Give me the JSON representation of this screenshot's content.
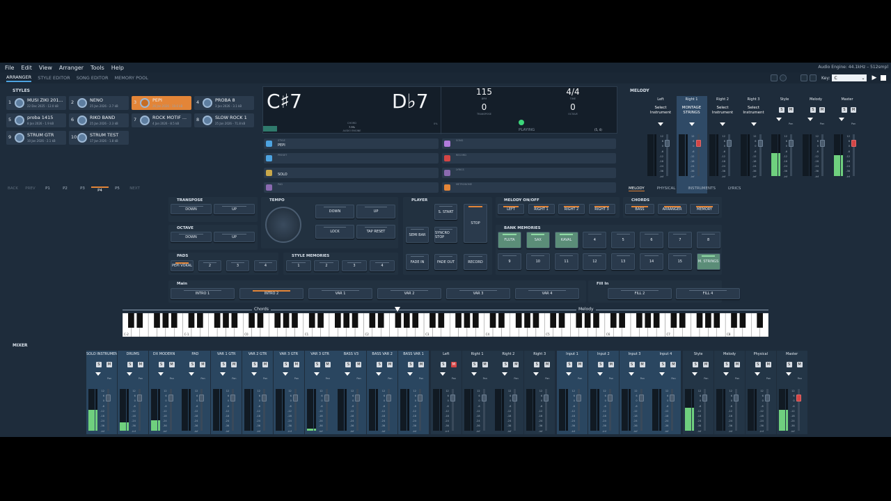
{
  "menu": [
    "File",
    "Edit",
    "View",
    "Arranger",
    "Tools",
    "Help"
  ],
  "engine_status": "Audio Engine: 44.1kHz – 512smpl",
  "tabs": [
    "ARRANGER",
    "STYLE EDITOR",
    "SONG EDITOR",
    "MEMORY POOL"
  ],
  "key_label": "Key:",
  "key_value": "C",
  "styles_title": "STYLES",
  "styles": [
    {
      "num": "1",
      "name": "MUSI ZIKI 201...",
      "date": "22 Dec 2025 - 12.0 kB"
    },
    {
      "num": "2",
      "name": "NENO",
      "date": "25 Jan 2026 - 2.7 kB"
    },
    {
      "num": "3",
      "name": "PEPI",
      "date": "26 Jan 2026 - 19.6 kB"
    },
    {
      "num": "4",
      "name": "PROBA 8",
      "date": "3 Jan 2026 - 3.1 kB"
    },
    {
      "num": "5",
      "name": "proba 1415",
      "date": "8 Jan 2026 - 1.9 kB"
    },
    {
      "num": "6",
      "name": "RIKO BAND",
      "date": "25 Jan 2026 - 2.3 kB"
    },
    {
      "num": "7",
      "name": "ROCK MOTIF ...",
      "date": "4 Jan 2026 - 8.5 kB"
    },
    {
      "num": "8",
      "name": "SLOW ROCK 1",
      "date": "25 Jan 2026 - 71.8 kB"
    },
    {
      "num": "9",
      "name": "STRUM GTR",
      "date": "10 Jan 2026 - 2.1 kB"
    },
    {
      "num": "10",
      "name": "STRUM TEST",
      "date": "17 Jan 2026 - 1.8 kB"
    }
  ],
  "pagenav": [
    "BACK",
    "PREV",
    "P1",
    "P2",
    "P3",
    "P4",
    "P5",
    "NEXT"
  ],
  "display": {
    "chord1": "C♯7",
    "chord2": "D♭7",
    "chord_label": "CHORD",
    "bpm": "115",
    "bpm_label": "BPM",
    "transpose": "0",
    "transpose_label": "TRANSPOSE",
    "time_sig": "4/4",
    "time_label": "TIME",
    "octave": "0",
    "octave_label": "OCTAVE",
    "engine_val": "7.9%",
    "engine_label": "AUDIO ENGINE",
    "playing": "PLAYING",
    "position": "(5, 4)",
    "pct": "0%"
  },
  "info_left": [
    {
      "label": "STYLE",
      "value": "PEPI",
      "color": "#4da3e0"
    },
    {
      "label": "PRESET",
      "value": "",
      "color": "#4da3e0"
    },
    {
      "label": "",
      "value": "SOLO",
      "color": "#c9a84a"
    },
    {
      "label": "PAD",
      "value": "",
      "color": "#8a6ab0"
    }
  ],
  "info_right": [
    {
      "label": "SONG",
      "value": "",
      "color": "#b07adb"
    },
    {
      "label": "RECORD",
      "value": "",
      "color": "#d34545"
    },
    {
      "label": "LYRICS",
      "value": "",
      "color": "#8a6ab0"
    },
    {
      "label": "METRONOME",
      "value": "",
      "color": "#e38538"
    }
  ],
  "melody_title": "MELODY",
  "melody_cols": [
    {
      "name": "Left",
      "sel": "Select Instrument"
    },
    {
      "name": "Right 1",
      "sel": "MONTAGE STRINGS"
    },
    {
      "name": "Right 2",
      "sel": "Select Instrument"
    },
    {
      "name": "Right 3",
      "sel": "Select Instrument"
    }
  ],
  "melody_out": [
    "Style",
    "Melody",
    "Master"
  ],
  "melody_tabs": [
    "MELODY",
    "PHYSICAL",
    "INSTRUMENTS",
    "LYRICS"
  ],
  "scale": [
    "12",
    "6",
    "0",
    "-6",
    "-12",
    "-18",
    "-24",
    "-36",
    "-inf"
  ],
  "pan": "Pan",
  "s": "S",
  "m": "M",
  "transpose": {
    "title": "TRANSPOSE",
    "down": "DOWN",
    "up": "UP"
  },
  "octave": {
    "title": "OCTAVE",
    "down": "DOWN",
    "up": "UP"
  },
  "tempo": {
    "title": "TEMPO",
    "down": "DOWN",
    "up": "UP",
    "lock": "LOCK",
    "tap": "TAP RESET"
  },
  "player": {
    "title": "PLAYER",
    "sstart": "S. START",
    "stop": "STOP",
    "semibar": "SEMI BAR",
    "syncro": "SYNCRO STOP",
    "fadein": "FADE IN",
    "fadeout": "FADE OUT",
    "record": "RECORD"
  },
  "melody_onoff": {
    "title": "MELODY ON/OFF",
    "items": [
      "LEFT",
      "RIGHT 1",
      "RIGHT 2",
      "RIGHT 3"
    ]
  },
  "chords": {
    "title": "CHORDS",
    "items": [
      "BASS",
      "ARRANGER",
      "MEMORY"
    ]
  },
  "bank": {
    "title": "BANK MEMORIES",
    "items": [
      "FLUTA",
      "SAX",
      "KAVAL",
      "4",
      "5",
      "6",
      "7",
      "8",
      "9",
      "10",
      "11",
      "12",
      "13",
      "14",
      "15",
      "M. STRINGS"
    ]
  },
  "pads": {
    "title": "PADS",
    "items": [
      "PEPI VOKAL",
      "2",
      "3",
      "4"
    ]
  },
  "stylemem": {
    "title": "STYLE MEMORIES",
    "items": [
      "1",
      "2",
      "3",
      "4"
    ]
  },
  "main": {
    "title": "Main",
    "items": [
      "INTRO 1",
      "INTRO 2",
      "VAR 1",
      "VAR 2",
      "VAR 3",
      "VAR 4"
    ]
  },
  "fillin": {
    "title": "Fill In",
    "items": [
      "FILL 2",
      "FILL 4"
    ]
  },
  "kb": {
    "chords": "Chords",
    "melody": "Melody",
    "octaves": [
      "C-2",
      "C-1",
      "C0",
      "C1",
      "C2",
      "C3",
      "C4",
      "C5",
      "C6",
      "C7",
      "C8"
    ]
  },
  "mixer_title": "MIXER",
  "mixer": [
    {
      "name": "SOLO INSTRUMENTS",
      "lvl": 0.5
    },
    {
      "name": "DRUMS",
      "lvl": 0.2
    },
    {
      "name": "DX MODERN",
      "lvl": 0.25
    },
    {
      "name": "PAD",
      "lvl": 0
    },
    {
      "name": "VAR 1 GTR",
      "lvl": 0
    },
    {
      "name": "VAR 2 GTR",
      "lvl": 0
    },
    {
      "name": "VAR 3 GTR",
      "lvl": 0
    },
    {
      "name": "VAR 3 GTR",
      "lvl": 0.05
    },
    {
      "name": "BASS V3",
      "lvl": 0
    },
    {
      "name": "BASS VAR 2",
      "lvl": 0
    },
    {
      "name": "BASS VAR 1",
      "lvl": 0
    },
    {
      "name": "Left",
      "lvl": 0,
      "red": true
    },
    {
      "name": "Right 1",
      "lvl": 0
    },
    {
      "name": "Right 2",
      "lvl": 0
    },
    {
      "name": "Right 3",
      "lvl": 0
    },
    {
      "name": "Input 1",
      "lvl": 0
    },
    {
      "name": "Input 2",
      "lvl": 0
    },
    {
      "name": "Input 3",
      "lvl": 0
    },
    {
      "name": "Input 4",
      "lvl": 0
    },
    {
      "name": "Style",
      "lvl": 0.55
    },
    {
      "name": "Melody",
      "lvl": 0
    },
    {
      "name": "Physical",
      "lvl": 0
    },
    {
      "name": "Master",
      "lvl": 0.5
    }
  ]
}
